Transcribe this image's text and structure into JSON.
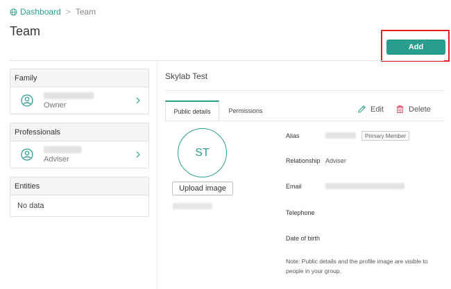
{
  "breadcrumb": {
    "home": "Dashboard",
    "separator": ">",
    "current": "Team"
  },
  "page": {
    "title": "Team"
  },
  "toolbar": {
    "add_label": "Add"
  },
  "sidebar": {
    "family": {
      "header": "Family",
      "role": "Owner"
    },
    "professionals": {
      "header": "Professionals",
      "role": "Adviser"
    },
    "entities": {
      "header": "Entities",
      "empty": "No data"
    }
  },
  "profile": {
    "name": "Skylab Test",
    "initials": "ST",
    "upload_label": "Upload image",
    "tabs": [
      {
        "label": "Public details"
      },
      {
        "label": "Permissions"
      }
    ],
    "actions": {
      "edit": "Edit",
      "delete": "Delete"
    },
    "fields": {
      "alias_label": "Alias",
      "alias_badge": "Primary Member",
      "relationship_label": "Relationship",
      "relationship_value": "Adviser",
      "email_label": "Email",
      "telephone_label": "Telephone",
      "dob_label": "Date of birth"
    },
    "note": "Note: Public details and the profile image are visible to people in your group."
  },
  "colors": {
    "accent": "#2a9d8f",
    "highlight": "#e01b24",
    "danger": "#e0405a"
  }
}
